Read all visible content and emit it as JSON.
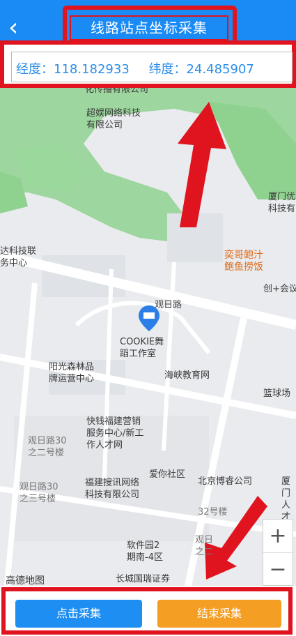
{
  "header": {
    "back_label": "<",
    "title": "线路站点坐标采集"
  },
  "coords": {
    "lng_label": "经度：",
    "lng": "118.182933",
    "lat_label": "纬度：",
    "lat": "24.485907"
  },
  "map": {
    "pois": [
      "化传播有限公司",
      "超娱网络科技有限公司",
      "厦门优科技有",
      "达科技联务中心",
      "奕哥鲍汁鲍鱼捞饭",
      "创+会议",
      "COOKIE舞蹈工作室",
      "阳光森林品牌运营中心",
      "海峡教育网",
      "篮球场",
      "快钱福建营销服务中心/新工作人才网",
      "观日路30之二号楼",
      "爱你社区",
      "北京博睿公司",
      "观日路30之三号楼",
      "福建搜讯网络科技有限公司",
      "厦门人才有",
      "32号楼",
      "软件园2期南-4区",
      "厦门",
      "观日之二",
      "长城国瑞证券"
    ],
    "road_name": "观日路",
    "logo_text": "高德地图",
    "zoom_in": "+",
    "zoom_out": "−"
  },
  "actions": {
    "collect_label": "点击采集",
    "finish_label": "结束采集"
  },
  "colors": {
    "primary": "#1a8af5",
    "accent_orange": "#f49e23",
    "annotation_red": "#e0141f"
  }
}
